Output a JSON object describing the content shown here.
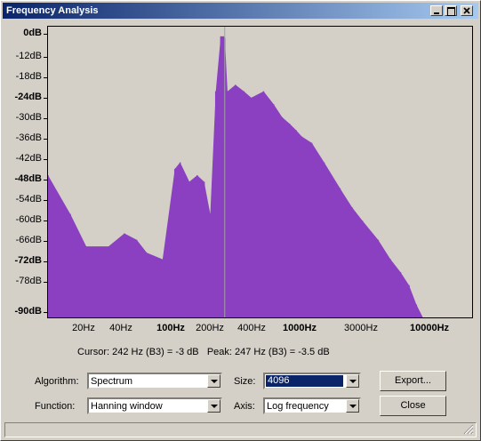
{
  "window": {
    "title": "Frequency Analysis"
  },
  "titlebar_buttons": {
    "minimize": "_",
    "maximize": "□",
    "close": "×"
  },
  "colors": {
    "spectrum": "#8a40c0",
    "peak_marker": "#a0a0a0",
    "plot_bg": "#d4d0c8",
    "title_start": "#0a246a",
    "title_end": "#a6caf0"
  },
  "y_axis": {
    "ticks": [
      {
        "label": "0dB",
        "bold": true
      },
      {
        "label": "-12dB",
        "bold": false
      },
      {
        "label": "-18dB",
        "bold": false
      },
      {
        "label": "-24dB",
        "bold": true
      },
      {
        "label": "-30dB",
        "bold": false
      },
      {
        "label": "-36dB",
        "bold": false
      },
      {
        "label": "-42dB",
        "bold": false
      },
      {
        "label": "-48dB",
        "bold": true
      },
      {
        "label": "-54dB",
        "bold": false
      },
      {
        "label": "-60dB",
        "bold": false
      },
      {
        "label": "-66dB",
        "bold": false
      },
      {
        "label": "-72dB",
        "bold": true
      },
      {
        "label": "-78dB",
        "bold": false
      },
      {
        "label": "-90dB",
        "bold": true
      }
    ]
  },
  "x_axis": {
    "ticks": [
      {
        "label": "20Hz",
        "bold": false
      },
      {
        "label": "40Hz",
        "bold": false
      },
      {
        "label": "100Hz",
        "bold": true
      },
      {
        "label": "200Hz",
        "bold": false
      },
      {
        "label": "400Hz",
        "bold": false
      },
      {
        "label": "1000Hz",
        "bold": true
      },
      {
        "label": "3000Hz",
        "bold": false
      },
      {
        "label": "10000Hz",
        "bold": true
      }
    ]
  },
  "chart_data": {
    "type": "area",
    "title": "",
    "xlabel": "",
    "ylabel": "",
    "x_scale": "log",
    "xlim": [
      10,
      22000
    ],
    "ylim": [
      -90,
      0
    ],
    "x": [
      10,
      15,
      20,
      30,
      40,
      50,
      60,
      80,
      100,
      110,
      130,
      150,
      170,
      190,
      210,
      230,
      242,
      247,
      260,
      300,
      350,
      400,
      500,
      600,
      700,
      800,
      900,
      1000,
      1200,
      1500,
      2000,
      2500,
      3000,
      4000,
      5000,
      6000,
      7000,
      8000,
      9000
    ],
    "y": [
      -46,
      -58,
      -68,
      -68,
      -64,
      -66,
      -70,
      -72,
      -44,
      -42,
      -48,
      -46,
      -48,
      -58,
      -20,
      -3,
      -3,
      -3.5,
      -20,
      -18,
      -20,
      -22,
      -20,
      -24,
      -28,
      -30,
      -32,
      -34,
      -36,
      -42,
      -50,
      -56,
      -60,
      -66,
      -72,
      -76,
      -80,
      -86,
      -90
    ]
  },
  "status": {
    "cursor": "Cursor: 242 Hz (B3) = -3 dB",
    "peak": "Peak: 247 Hz (B3) = -3.5 dB"
  },
  "controls": {
    "algorithm_label": "Algorithm:",
    "algorithm_value": "Spectrum",
    "size_label": "Size:",
    "size_value": "4096",
    "function_label": "Function:",
    "function_value": "Hanning window",
    "axis_label": "Axis:",
    "axis_value": "Log frequency",
    "export_button": "Export...",
    "close_button": "Close"
  }
}
